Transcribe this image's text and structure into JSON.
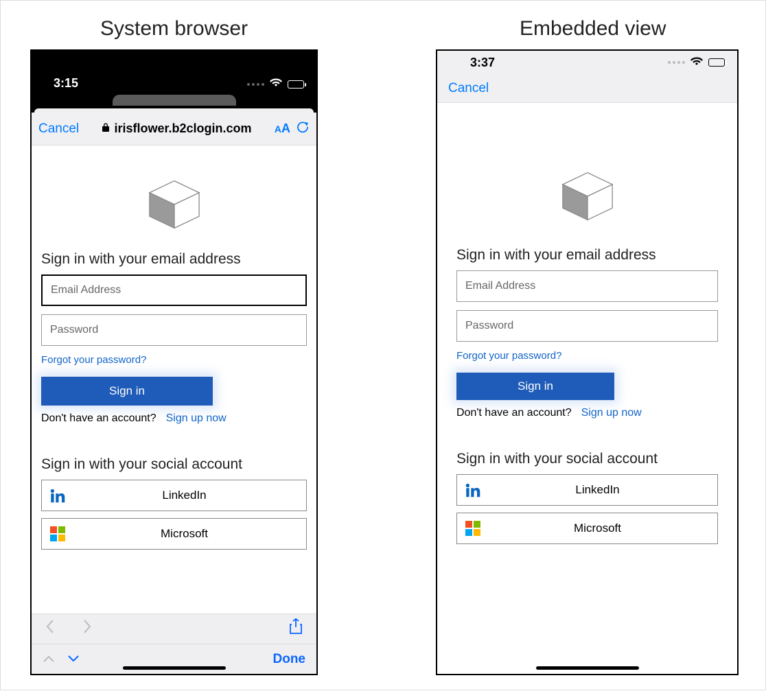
{
  "titles": {
    "left": "System browser",
    "right": "Embedded view"
  },
  "p1": {
    "status_time": "3:15",
    "cancel": "Cancel",
    "url": "irisflower.b2clogin.com",
    "text_size": "AA",
    "heading_email": "Sign in with your email address",
    "email_placeholder": "Email Address",
    "password_placeholder": "Password",
    "forgot": "Forgot your password?",
    "signin": "Sign in",
    "no_account": "Don't have an account?",
    "signup": "Sign up now",
    "heading_social": "Sign in with your social account",
    "social": {
      "linkedin": "LinkedIn",
      "microsoft": "Microsoft"
    },
    "done": "Done"
  },
  "p2": {
    "status_time": "3:37",
    "cancel": "Cancel",
    "heading_email": "Sign in with your email address",
    "email_placeholder": "Email Address",
    "password_placeholder": "Password",
    "forgot": "Forgot your password?",
    "signin": "Sign in",
    "no_account": "Don't have an account?",
    "signup": "Sign up now",
    "heading_social": "Sign in with your social account",
    "social": {
      "linkedin": "LinkedIn",
      "microsoft": "Microsoft"
    }
  }
}
